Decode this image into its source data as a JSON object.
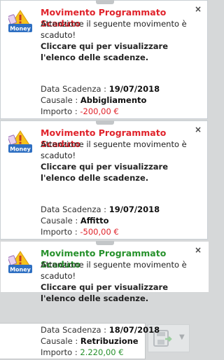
{
  "notifications": [
    {
      "title": "Movimento Programmato Scaduto",
      "title_color": "#e0232b",
      "message": "Attenzione il seguente movimento è scaduto!",
      "link": "Cliccare qui per visualizzare l'elenco delle scadenze.",
      "due_label": "Data Scadenza : ",
      "due_value": "19/07/2018",
      "cause_label": "Causale : ",
      "cause_value": "Abbigliamento",
      "amount_label": "Importo : ",
      "amount_value": "-200,00 €",
      "amount_color": "#e0232b",
      "close": "×",
      "logo_text": "Money"
    },
    {
      "title": "Movimento Programmato Scaduto",
      "title_color": "#e0232b",
      "message": "Attenzione il seguente movimento è scaduto!",
      "link": "Cliccare qui per visualizzare l'elenco delle scadenze.",
      "due_label": "Data Scadenza : ",
      "due_value": "19/07/2018",
      "cause_label": "Causale : ",
      "cause_value": "Affitto",
      "amount_label": "Importo : ",
      "amount_value": "-500,00 €",
      "amount_color": "#e0232b",
      "close": "×",
      "logo_text": "Money"
    },
    {
      "title": "Movimento Programmato Scaduto",
      "title_color": "#26912b",
      "message": "Attenzione il seguente movimento è scaduto!",
      "link": "Cliccare qui per visualizzare l'elenco delle scadenze.",
      "due_label": "Data Scadenza : ",
      "due_value": "18/07/2018",
      "cause_label": "Causale : ",
      "cause_value": "Retribuzione",
      "amount_label": "Importo : ",
      "amount_value": "2.220,00 €",
      "amount_color": "#26912b",
      "close": "×",
      "logo_text": "Money"
    }
  ],
  "background": {
    "save_icon": "floppy-save-icon",
    "dropdown_icon": "chevron-down-icon"
  }
}
